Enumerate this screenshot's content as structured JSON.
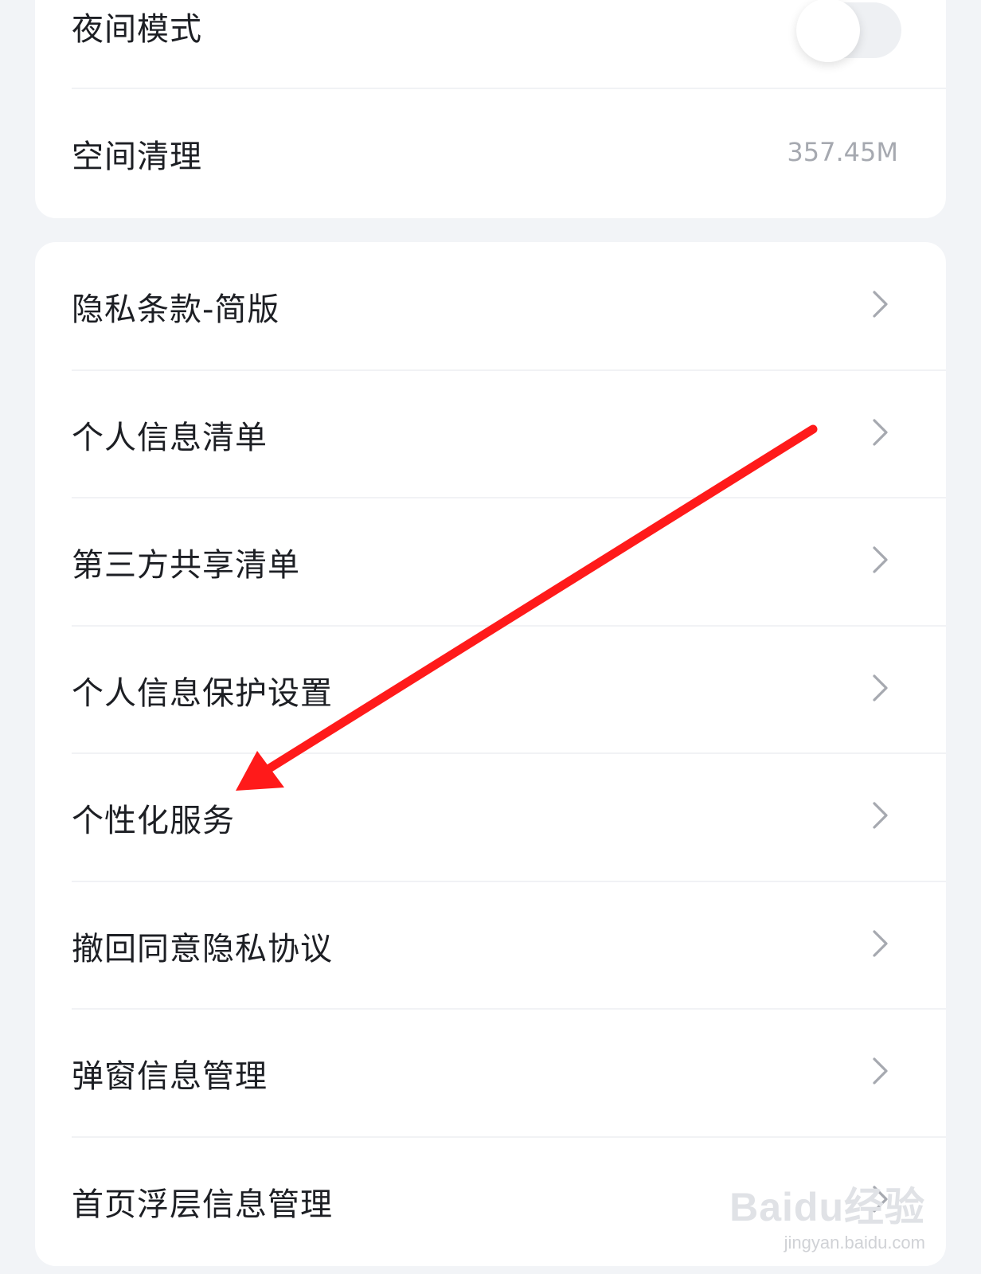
{
  "settings_top": {
    "night_mode": {
      "label": "夜间模式",
      "toggle_on": false
    },
    "space_cleanup": {
      "label": "空间清理",
      "value": "357.45M"
    }
  },
  "settings_privacy": {
    "items": [
      {
        "label": "隐私条款-简版"
      },
      {
        "label": "个人信息清单"
      },
      {
        "label": "第三方共享清单"
      },
      {
        "label": "个人信息保护设置"
      },
      {
        "label": "个性化服务"
      },
      {
        "label": "撤回同意隐私协议"
      },
      {
        "label": "弹窗信息管理"
      },
      {
        "label": "首页浮层信息管理"
      }
    ]
  },
  "annotation": {
    "arrow_color": "#ff1a1a",
    "target": "个性化服务"
  },
  "watermark": {
    "logo": "Baidu经验",
    "url": "jingyan.baidu.com"
  },
  "colors": {
    "background": "#f2f4f7",
    "card": "#ffffff",
    "label_text": "#1d1f24",
    "secondary_text": "#a6a9b0",
    "chevron": "#a6a9b0"
  }
}
